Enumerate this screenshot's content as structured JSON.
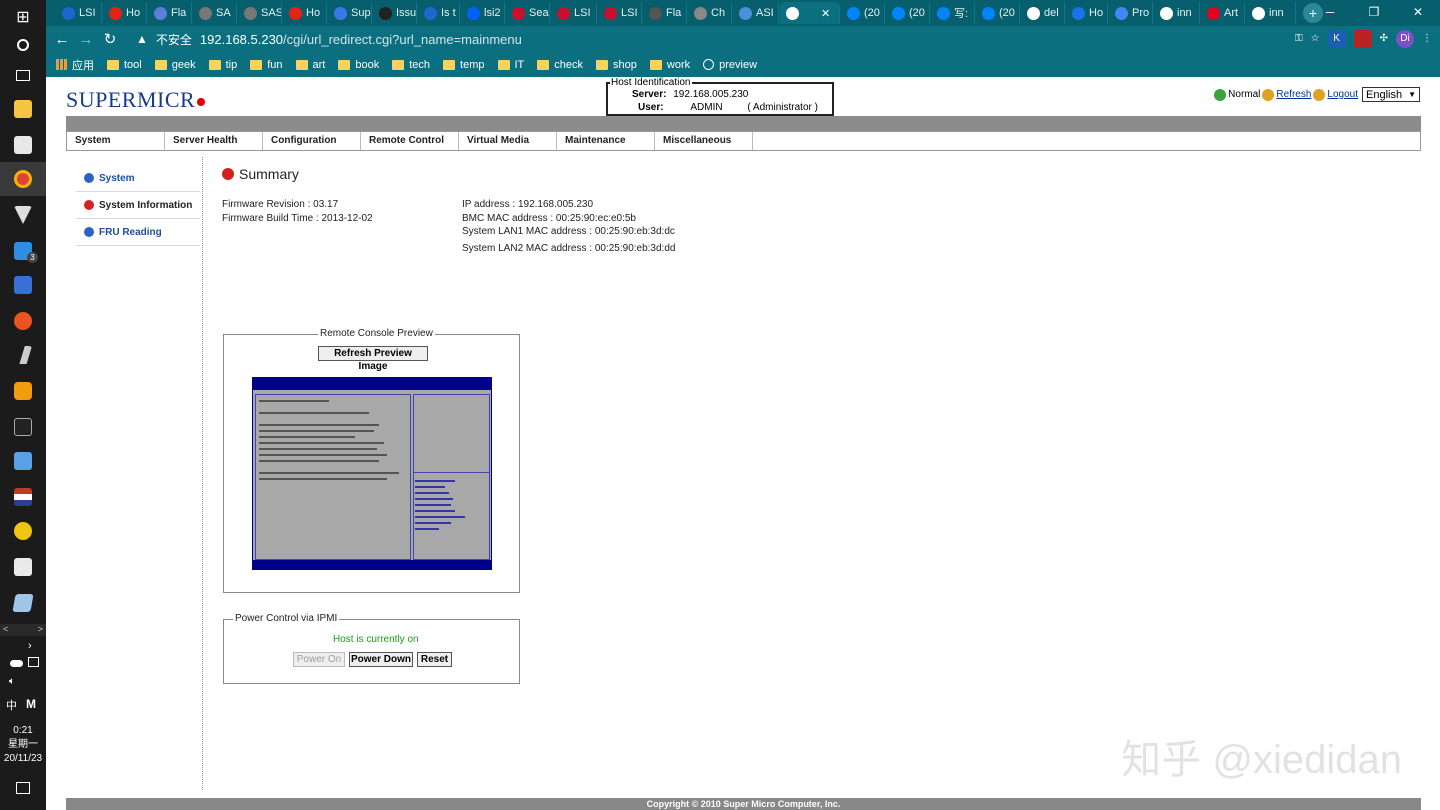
{
  "taskbar": {
    "start_glyph": "⊞",
    "mail_badge": "3",
    "clock_time": "0:21",
    "clock_day": "星期一",
    "clock_date": "20/11/23",
    "ime": "中",
    "m_glyph": "M"
  },
  "browser": {
    "tabs": [
      {
        "label": "LSI",
        "color": "#1e66d0"
      },
      {
        "label": "Ho",
        "color": "#e62117"
      },
      {
        "label": "Fla",
        "color": "#5b7fd9"
      },
      {
        "label": "SA",
        "color": "#777777"
      },
      {
        "label": "SAS",
        "color": "#777777"
      },
      {
        "label": "Ho",
        "color": "#e62117"
      },
      {
        "label": "Sup",
        "color": "#3b78e7"
      },
      {
        "label": "Issu",
        "color": "#222222"
      },
      {
        "label": "Is t",
        "color": "#1e66d0"
      },
      {
        "label": "lsi2",
        "color": "#0061fe"
      },
      {
        "label": "Sea",
        "color": "#c8102e"
      },
      {
        "label": "LSI",
        "color": "#c8102e"
      },
      {
        "label": "LSI",
        "color": "#c8102e"
      },
      {
        "label": "Fla",
        "color": "#555555"
      },
      {
        "label": "Ch",
        "color": "#888888"
      },
      {
        "label": "ASI",
        "color": "#4a90d9"
      },
      {
        "label": "",
        "color": "#ffffff"
      },
      {
        "label": "(20",
        "color": "#0084ff"
      },
      {
        "label": "(20",
        "color": "#0084ff"
      },
      {
        "label": "写:",
        "color": "#0084ff"
      },
      {
        "label": "(20",
        "color": "#0084ff"
      },
      {
        "label": "del",
        "color": "#ffffff"
      },
      {
        "label": "Ho",
        "color": "#1a73e8"
      },
      {
        "label": "Pro",
        "color": "#4285f4"
      },
      {
        "label": "inn",
        "color": "#ffffff"
      },
      {
        "label": "Art",
        "color": "#e60023"
      },
      {
        "label": "inn",
        "color": "#ffffff"
      }
    ],
    "active_close": "✕",
    "new_tab": "+",
    "insecure_label": "不安全",
    "url_host": "192.168.5.230",
    "url_path": "/cgi/url_redirect.cgi?url_name=mainmenu",
    "ext_k": "K",
    "ext_di": "Di",
    "bookmarks": [
      "应用",
      "tool",
      "geek",
      "tip",
      "fun",
      "art",
      "book",
      "tech",
      "temp",
      "IT",
      "check",
      "shop",
      "work",
      "preview"
    ]
  },
  "header": {
    "logo": "SUPERMICR",
    "host_legend": "Host Identification",
    "server_label": "Server:",
    "server_value": "192.168.005.230",
    "user_label": "User:",
    "user_value": "ADMIN",
    "user_role": "( Administrator )",
    "status_normal": "Normal",
    "refresh": "Refresh",
    "logout": "Logout",
    "language": "English"
  },
  "menu": [
    "System",
    "Server Health",
    "Configuration",
    "Remote Control",
    "Virtual Media",
    "Maintenance",
    "Miscellaneous"
  ],
  "sidebar": [
    "System",
    "System Information",
    "FRU Reading"
  ],
  "summary": {
    "title": "Summary",
    "fw_rev_label": "Firmware Revision :",
    "fw_rev_value": "03.17",
    "fw_build_label": "Firmware Build Time :",
    "fw_build_value": "2013-12-02",
    "ip_label": "IP address :",
    "ip_value": "192.168.005.230",
    "bmc_mac_label": "BMC MAC address :",
    "bmc_mac_value": "00:25:90:ec:e0:5b",
    "lan1_label": "System LAN1 MAC address :",
    "lan1_value": "00:25:90:eb:3d:dc",
    "lan2_label": "System LAN2 MAC address :",
    "lan2_value": "00:25:90:eb:3d:dd"
  },
  "console": {
    "legend": "Remote Console Preview",
    "refresh_button": "Refresh Preview Image"
  },
  "power": {
    "legend": "Power Control via IPMI",
    "status": "Host is currently on",
    "power_on": "Power On",
    "power_down": "Power Down",
    "reset": "Reset"
  },
  "watermark": "知乎 @xiedidan",
  "footer": "Copyright © 2010 Super Micro Computer, Inc."
}
